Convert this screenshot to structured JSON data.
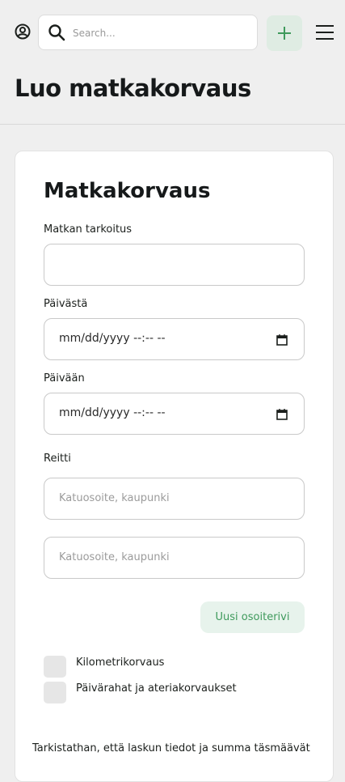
{
  "header": {
    "search": {
      "placeholder": "Search..."
    },
    "title": "Luo matkakorvaus"
  },
  "form": {
    "title": "Matkakorvaus",
    "purpose": {
      "label": "Matkan tarkoitus",
      "value": ""
    },
    "from_date": {
      "label": "Päivästä",
      "value": "mm/dd/yyyy --:-- --"
    },
    "to_date": {
      "label": "Päivään",
      "value": "mm/dd/yyyy --:-- --"
    },
    "route": {
      "label": "Reitti",
      "addresses": [
        {
          "placeholder": "Katuosoite, kaupunki"
        },
        {
          "placeholder": "Katuosoite, kaupunki"
        }
      ],
      "add_row_label": "Uusi osoiterivi"
    },
    "options": [
      {
        "label": "Kilometrikorvaus",
        "checked": false
      },
      {
        "label": "Päivärahat ja ateriakorvaukset",
        "checked": false
      }
    ],
    "note": "Tarkistathan, että laskun tiedot ja summa täsmäävät"
  },
  "colors": {
    "accent": "#3f9a5c",
    "accent_bg": "#dfece3",
    "page_bg": "#efefef"
  }
}
